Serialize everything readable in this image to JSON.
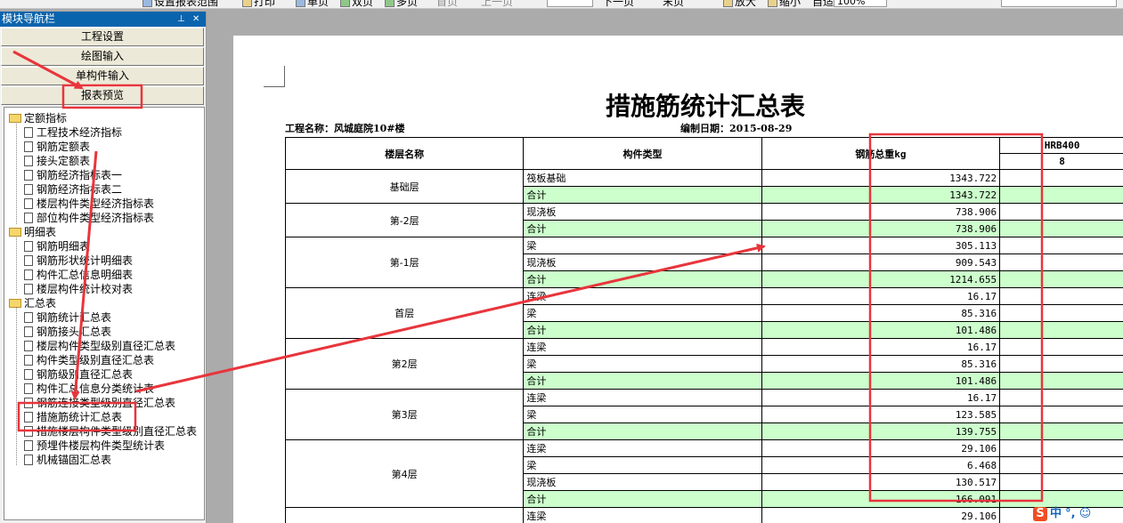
{
  "toolbar": {
    "items": [
      {
        "label": "设置报表范围"
      },
      {
        "label": "打印"
      },
      {
        "label": "单页"
      },
      {
        "label": "双页"
      },
      {
        "label": "多页"
      },
      {
        "label": "首页"
      },
      {
        "label": "上一页"
      },
      {
        "label": "下一页"
      },
      {
        "label": "末页"
      },
      {
        "label": "放大"
      },
      {
        "label": "缩小"
      },
      {
        "label": "自适应"
      }
    ],
    "zoom": "100",
    "zoom_unit": "%"
  },
  "sidebar": {
    "title": "模块导航栏",
    "pin_icon": "pin-icon",
    "close_icon": "close-icon",
    "modules": [
      "工程设置",
      "绘图输入",
      "单构件输入",
      "报表预览"
    ],
    "tree": [
      {
        "type": "folder",
        "label": "定额指标",
        "children": [
          "工程技术经济指标",
          "钢筋定额表",
          "接头定额表",
          "钢筋经济指标表一",
          "钢筋经济指标表二",
          "楼层构件类型经济指标表",
          "部位构件类型经济指标表"
        ]
      },
      {
        "type": "folder",
        "label": "明细表",
        "children": [
          "钢筋明细表",
          "钢筋形状统计明细表",
          "构件汇总信息明细表",
          "楼层构件统计校对表"
        ]
      },
      {
        "type": "folder",
        "label": "汇总表",
        "children": [
          "钢筋统计汇总表",
          "钢筋接头汇总表",
          "楼层构件类型级别直径汇总表",
          "构件类型级别直径汇总表",
          "钢筋级别直径汇总表",
          "构件汇总信息分类统计表",
          "钢筋连接类型级别直径汇总表",
          "措施筋统计汇总表",
          "措施楼层构件类型级别直径汇总表",
          "预埋件楼层构件类型统计表",
          "机械锚固汇总表"
        ]
      }
    ],
    "selected": "措施筋统计汇总表"
  },
  "report": {
    "title": "措施筋统计汇总表",
    "project_label": "工程名称：",
    "project_name": "风城庭院10#楼",
    "date_label": "编制日期：",
    "date": "2015-08-29",
    "headers": {
      "floor": "楼层名称",
      "component": "构件类型",
      "weight": "钢筋总重kg",
      "grade": "HRB400",
      "diameter": "8"
    },
    "groups": [
      {
        "floor": "基础层",
        "rows": [
          {
            "c": "筏板基础",
            "w": "1343.722"
          },
          {
            "c": "合计",
            "w": "1343.722",
            "sub": true
          }
        ]
      },
      {
        "floor": "第-2层",
        "rows": [
          {
            "c": "现浇板",
            "w": "738.906"
          },
          {
            "c": "合计",
            "w": "738.906",
            "sub": true
          }
        ]
      },
      {
        "floor": "第-1层",
        "rows": [
          {
            "c": "梁",
            "w": "305.113"
          },
          {
            "c": "现浇板",
            "w": "909.543"
          },
          {
            "c": "合计",
            "w": "1214.655",
            "sub": true
          }
        ]
      },
      {
        "floor": "首层",
        "rows": [
          {
            "c": "连梁",
            "w": "16.17"
          },
          {
            "c": "梁",
            "w": "85.316"
          },
          {
            "c": "合计",
            "w": "101.486",
            "sub": true
          }
        ]
      },
      {
        "floor": "第2层",
        "rows": [
          {
            "c": "连梁",
            "w": "16.17"
          },
          {
            "c": "梁",
            "w": "85.316"
          },
          {
            "c": "合计",
            "w": "101.486",
            "sub": true
          }
        ]
      },
      {
        "floor": "第3层",
        "rows": [
          {
            "c": "连梁",
            "w": "16.17"
          },
          {
            "c": "梁",
            "w": "123.585"
          },
          {
            "c": "合计",
            "w": "139.755",
            "sub": true
          }
        ]
      },
      {
        "floor": "第4层",
        "rows": [
          {
            "c": "连梁",
            "w": "29.106"
          },
          {
            "c": "梁",
            "w": "6.468"
          },
          {
            "c": "现浇板",
            "w": "130.517"
          },
          {
            "c": "合计",
            "w": "166.091",
            "sub": true
          }
        ]
      },
      {
        "floor": "",
        "rows": [
          {
            "c": "连梁",
            "w": "29.106"
          }
        ]
      }
    ]
  },
  "ime": {
    "logo": "S",
    "mode": "中",
    "punct": "°,",
    "emoji": "☺"
  },
  "annotations": {
    "color": "#e8353c"
  }
}
